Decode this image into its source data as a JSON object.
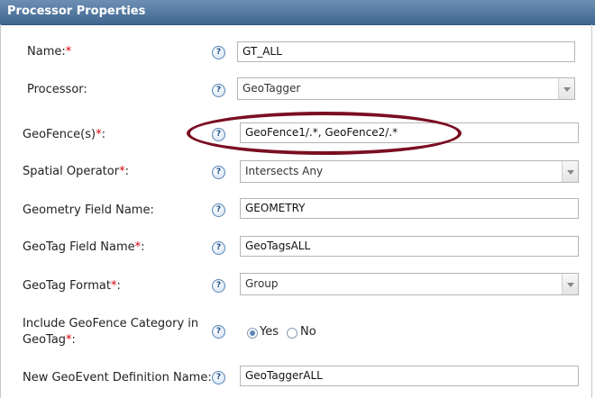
{
  "panel": {
    "title": "Processor Properties"
  },
  "fields": {
    "name": {
      "label": "Name:",
      "value": "GT_ALL"
    },
    "processor": {
      "label": "Processor:",
      "value": "GeoTagger"
    },
    "geofences": {
      "label": "GeoFence(s)",
      "suffix": ":",
      "value": "GeoFence1/.*, GeoFence2/.*"
    },
    "spatial_operator": {
      "label": "Spatial Operator",
      "suffix": ":",
      "value": "Intersects Any"
    },
    "geometry_field": {
      "label": "Geometry Field Name:",
      "value": "GEOMETRY"
    },
    "geotag_field": {
      "label": "GeoTag Field Name",
      "suffix": ":",
      "value": "GeoTagsALL"
    },
    "geotag_format": {
      "label": "GeoTag Format",
      "suffix": ":",
      "value": "Group"
    },
    "include_category": {
      "label_line1": "Include GeoFence Category in",
      "label_line2": "GeoTag",
      "suffix": ":",
      "options": [
        "Yes",
        "No"
      ],
      "selected": "Yes"
    },
    "new_definition": {
      "label": "New GeoEvent Definition Name:",
      "value": "GeoTaggerALL"
    }
  },
  "required_marker": "*",
  "help_glyph": "?",
  "icons": {
    "help": "question-mark-help-icon",
    "dropdown": "chevron-down-icon"
  },
  "colors": {
    "title_bar": "#3f6690",
    "required": "#d8000c",
    "annotation_ellipse": "#7a0e22"
  }
}
